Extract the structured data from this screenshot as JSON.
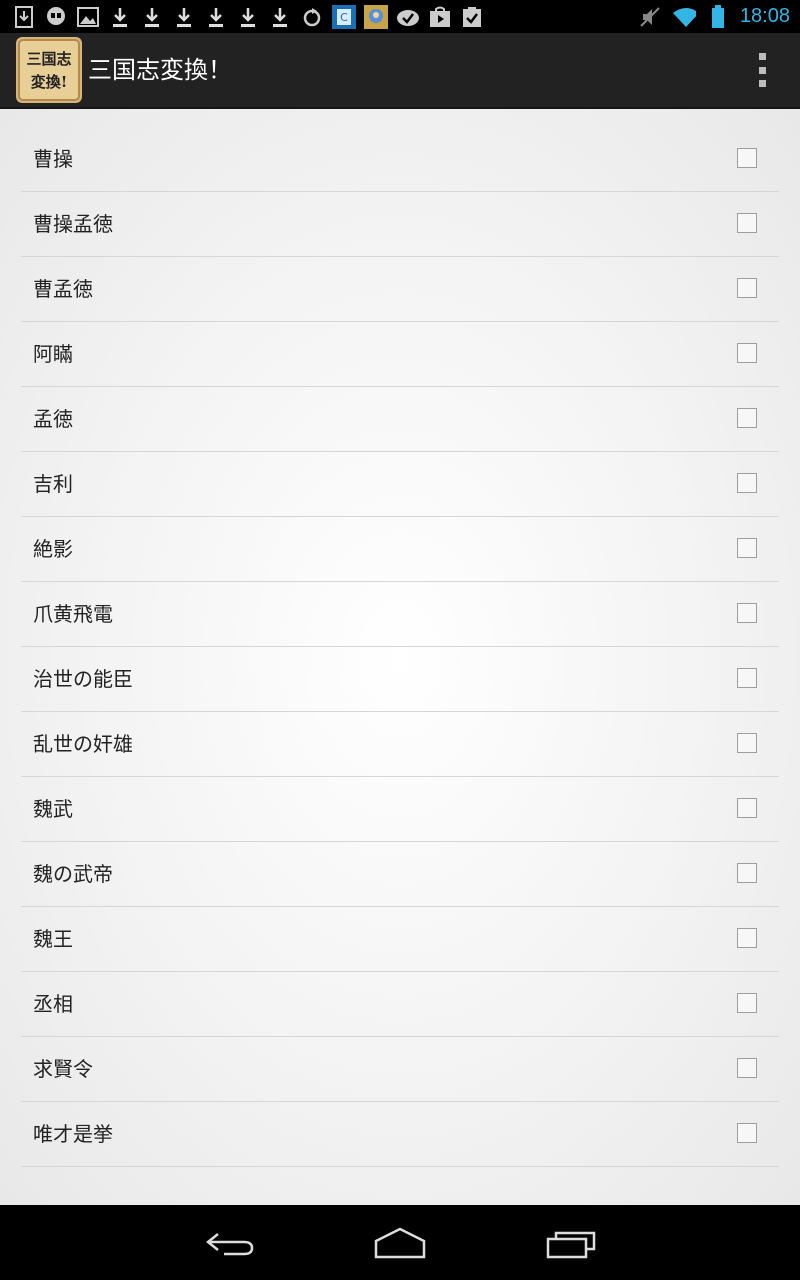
{
  "status_bar": {
    "time": "18:08",
    "notification_icons": [
      "download-box-icon",
      "hangouts-icon",
      "image-icon",
      "download-icon",
      "download-icon",
      "download-icon",
      "download-icon",
      "download-icon",
      "download-icon",
      "refresh-icon",
      "app-c-icon",
      "game-icon",
      "check-cloud-icon",
      "play-store-icon",
      "clipboard-check-icon"
    ],
    "system_icons": [
      "mute-icon",
      "wifi-icon",
      "battery-icon"
    ]
  },
  "action_bar": {
    "title": "三国志変換！",
    "logo_text": "三国志変換！"
  },
  "list": {
    "items": [
      {
        "label": "曹操",
        "checked": false
      },
      {
        "label": "曹操孟徳",
        "checked": false
      },
      {
        "label": "曹孟徳",
        "checked": false
      },
      {
        "label": "阿瞞",
        "checked": false
      },
      {
        "label": "孟徳",
        "checked": false
      },
      {
        "label": "吉利",
        "checked": false
      },
      {
        "label": "絶影",
        "checked": false
      },
      {
        "label": "爪黄飛電",
        "checked": false
      },
      {
        "label": "治世の能臣",
        "checked": false
      },
      {
        "label": "乱世の奸雄",
        "checked": false
      },
      {
        "label": "魏武",
        "checked": false
      },
      {
        "label": "魏の武帝",
        "checked": false
      },
      {
        "label": "魏王",
        "checked": false
      },
      {
        "label": "丞相",
        "checked": false
      },
      {
        "label": "求賢令",
        "checked": false
      },
      {
        "label": "唯才是挙",
        "checked": false
      }
    ]
  },
  "nav_bar": {
    "buttons": [
      "back-icon",
      "home-icon",
      "recent-apps-icon"
    ]
  },
  "colors": {
    "status_bar_bg": "#000000",
    "clock": "#33b5e5",
    "action_bar_bg": "#222222",
    "list_text": "#222222",
    "divider": "#d6d6d6"
  }
}
